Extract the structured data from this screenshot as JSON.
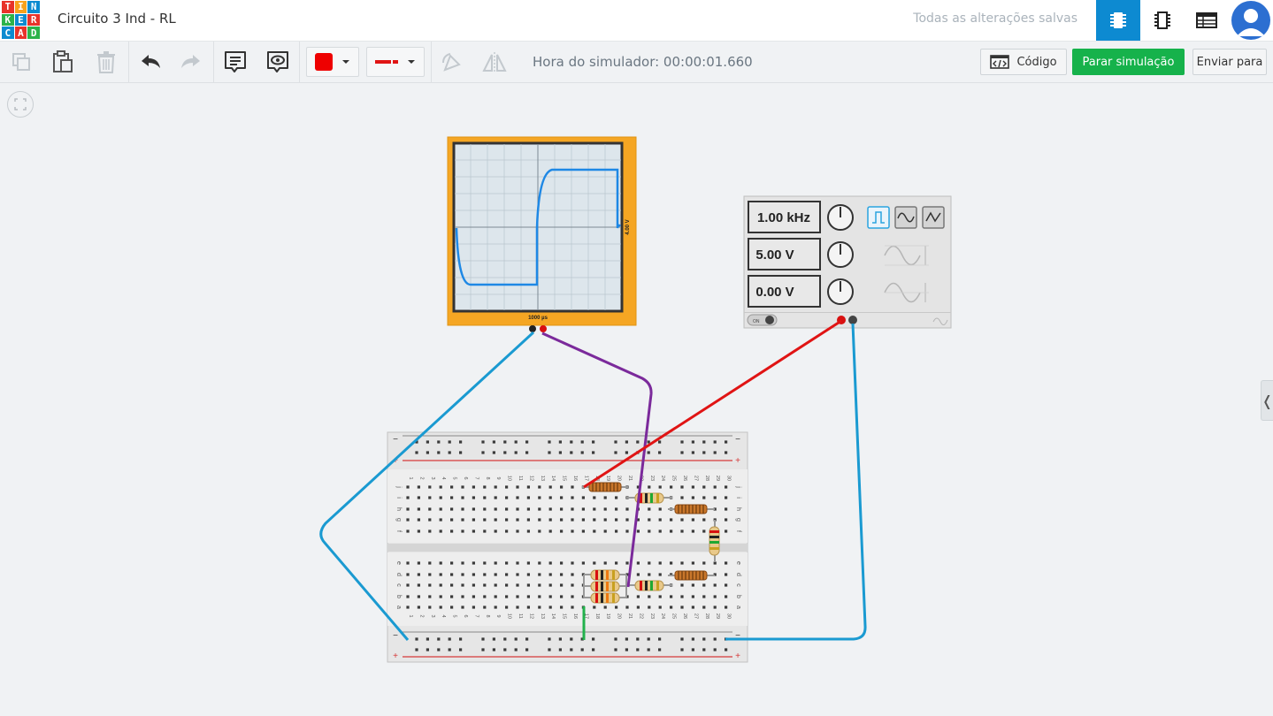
{
  "app": {
    "logo_letters": [
      "T",
      "I",
      "N",
      "K",
      "E",
      "R",
      "C",
      "A",
      "D"
    ],
    "title": "Circuito 3 Ind - RL",
    "save_status": "Todas as alterações salvas",
    "views": [
      {
        "name": "circuit-view-icon",
        "active": true
      },
      {
        "name": "components-list-icon",
        "active": false
      },
      {
        "name": "schematic-list-icon",
        "active": false
      }
    ]
  },
  "toolbar": {
    "color_swatch": "#ee0000",
    "sim_time_label": "Hora do simulador: 00:00:01.660",
    "code_label": "Código",
    "stop_label": "Parar simulação",
    "send_label": "Enviar para"
  },
  "oscilloscope": {
    "y_label": "4.00 V",
    "x_label": "1000 µs"
  },
  "generator": {
    "frequency": "1.00 kHz",
    "amplitude": "5.00 V",
    "offset": "0.00 V",
    "power_label": "ON",
    "selected_waveform": "square"
  },
  "breadboard": {
    "columns": [
      "1",
      "2",
      "3",
      "4",
      "5",
      "6",
      "7",
      "8",
      "9",
      "10",
      "11",
      "12",
      "13",
      "14",
      "15",
      "16",
      "17",
      "18",
      "19",
      "20",
      "21",
      "22",
      "23",
      "24",
      "25",
      "26",
      "27",
      "28",
      "29",
      "30"
    ],
    "rows_top": [
      "j",
      "i",
      "h",
      "g",
      "f"
    ],
    "rows_bottom": [
      "e",
      "d",
      "c",
      "b",
      "a"
    ],
    "rail_minus": "−",
    "rail_plus": "+"
  },
  "colors": {
    "brand_blue": "#0d8ad1",
    "stop_green": "#16b24b",
    "scope_frame": "#f5a623",
    "wire_blue": "#1a9ad1",
    "wire_red": "#e01414",
    "wire_purple": "#7b2a9b",
    "wire_green": "#22b24c"
  }
}
